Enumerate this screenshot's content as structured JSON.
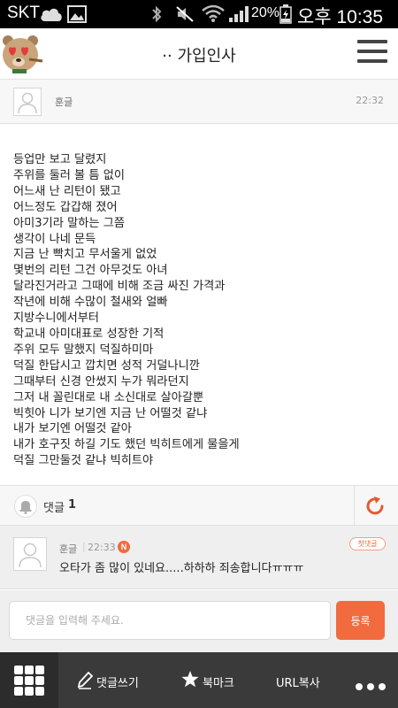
{
  "status_bar": {
    "carrier": "SKT",
    "battery": "20%",
    "time": "오후 10:35",
    "icons": [
      "cloud-icon",
      "image-icon",
      "bluetooth-icon",
      "mute-icon",
      "wifi-icon",
      "signal-icon",
      "battery-icon"
    ]
  },
  "header": {
    "title": "·· 가입인사",
    "logo_icon": "bear-avatar-icon",
    "menu_icon": "hamburger-menu-icon"
  },
  "post": {
    "author": "훈글",
    "time": "22:32",
    "lines": [
      "등업만 보고 달렸지",
      "주위를 둘러 볼 틈 없이",
      "어느새 난 리턴이 됐고",
      "어느정도 갑갑해 졌어",
      "아미3기라 말하는 그쯤",
      "생각이 나네 문득",
      "지금 난 빡치고 무서울게 없었",
      "몇번의 리턴 그건 아무것도 아녀",
      "달라진거라고 그때에 비해 조금 싸진 가격과",
      "작년에 비해 수많이 철새와 얼빠",
      "지방수니에서부터",
      "학교내 아미대표로 성장한 기적",
      "주위 모두 말했지 덕질하미마",
      "덕질 한답시고 깝치면 성적 거덜나니깐",
      "그때부터 신경 안썼지 누가 뭐라던지",
      "그저 내 꼴린대로 내 소신대로 살아갈뿐",
      "빅힛아 니가 보기엔 지금 난 어떨것 같냐",
      "내가 보기엔 어떨것 같아",
      "내가 호구짓 하길 기도 했던 빅히트에게 물을게",
      "덕질 그만둘것 같냐 빅히트야"
    ]
  },
  "comments_bar": {
    "label": "댓글",
    "count": "1"
  },
  "comment": {
    "author": "훈글",
    "separator": "|",
    "time": "22:33",
    "new_badge": "N",
    "text": "오타가 좀 많이 있네요.....하하하 죄송합니다ㅠㅠㅠ",
    "reply_label": "첫댓글"
  },
  "input": {
    "placeholder": "댓글을 입력해 주세요.",
    "submit_label": "등록"
  },
  "bottom_bar": {
    "write_comment": "댓글쓰기",
    "bookmark": "북마크",
    "copy_url": "URL복사"
  },
  "colors": {
    "accent": "#f16b3f",
    "status_bar": "#000000",
    "bottom_bar": "#3a3a3a"
  }
}
